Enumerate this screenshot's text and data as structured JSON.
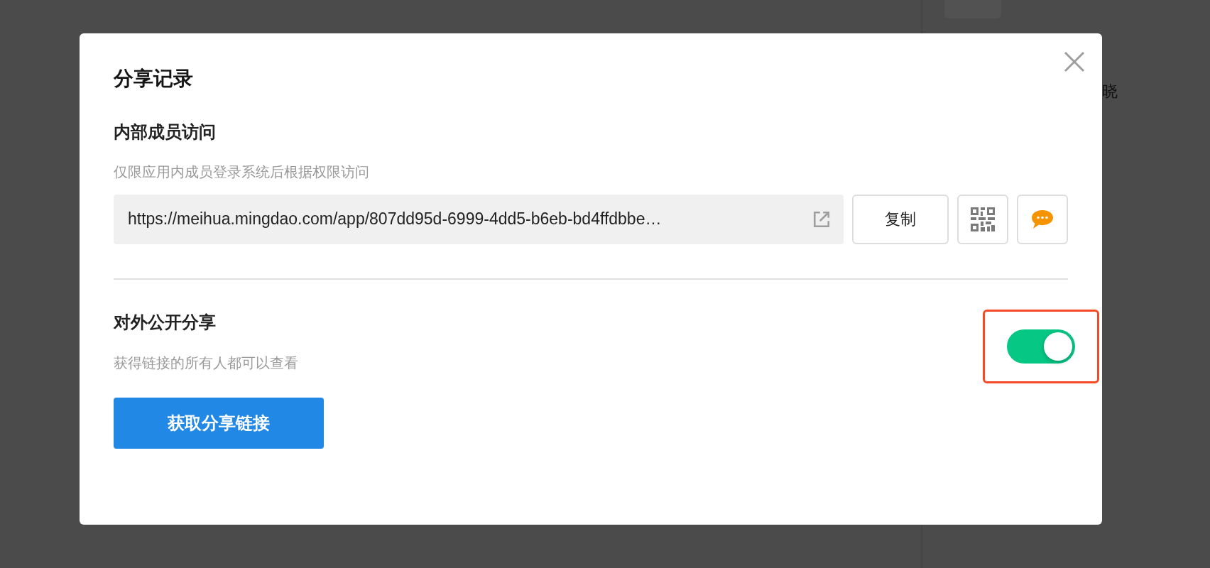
{
  "background": {
    "side_text": "晓"
  },
  "dialog": {
    "title": "分享记录",
    "internal": {
      "title": "内部成员访问",
      "description": "仅限应用内成员登录系统后根据权限访问",
      "url": "https://meihua.mingdao.com/app/807dd95d-6999-4dd5-b6eb-bd4ffdbbe…",
      "copy_button": "复制"
    },
    "public": {
      "title": "对外公开分享",
      "description": "获得链接的所有人都可以查看",
      "on": true,
      "highlighted": true,
      "button": "获取分享链接"
    }
  }
}
